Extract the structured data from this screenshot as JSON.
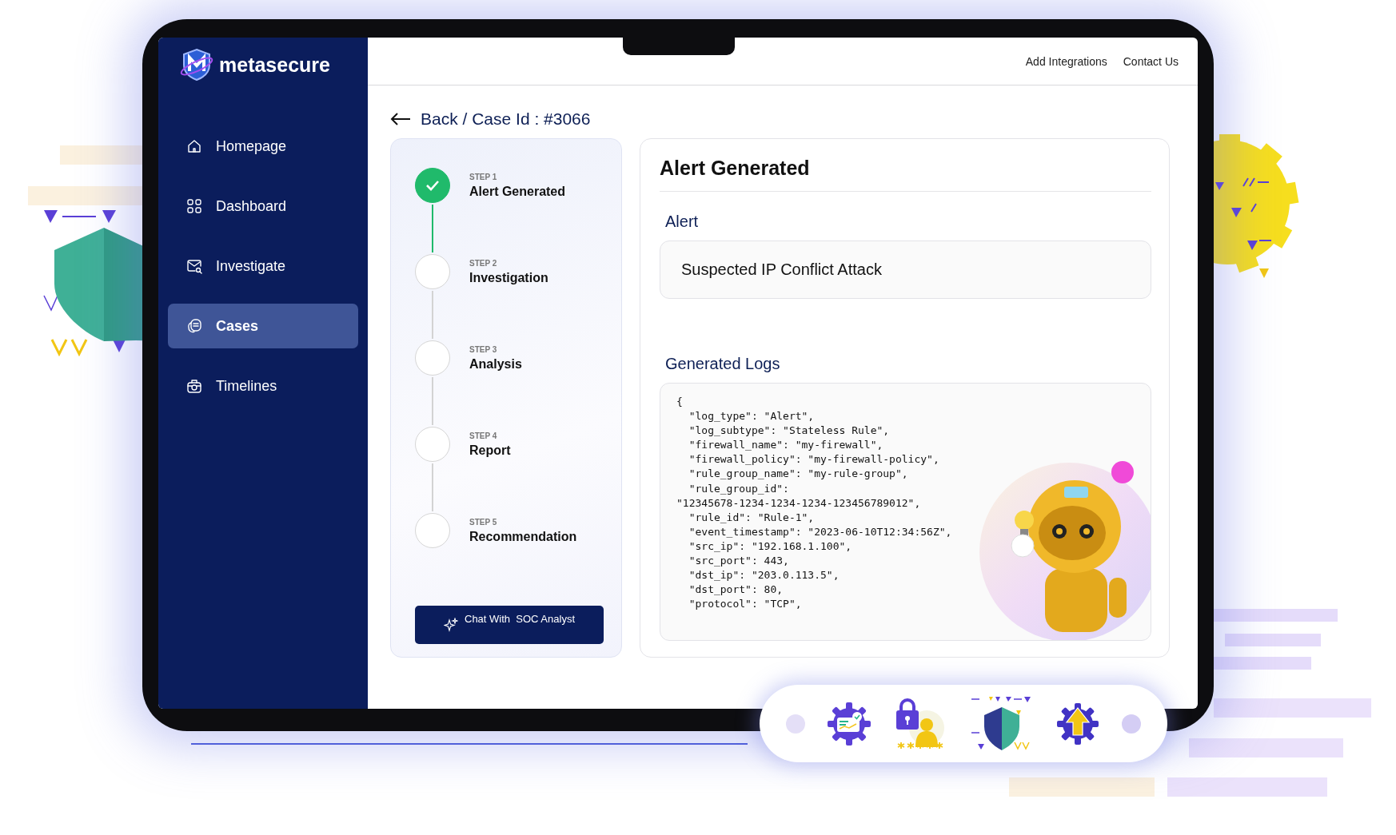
{
  "brand": {
    "name": "metasecure"
  },
  "sidebar": {
    "items": [
      {
        "label": "Homepage",
        "selected": false
      },
      {
        "label": "Dashboard",
        "selected": false
      },
      {
        "label": "Investigate",
        "selected": false
      },
      {
        "label": "Cases",
        "selected": true
      },
      {
        "label": "Timelines",
        "selected": false
      }
    ]
  },
  "header": {
    "links": [
      "Add Integrations",
      "Contact Us"
    ]
  },
  "breadcrumb": "Back / Case Id : #3066",
  "steps": [
    {
      "step": "STEP 1",
      "title": "Alert Generated",
      "done": true
    },
    {
      "step": "STEP 2",
      "title": "Investigation",
      "done": false
    },
    {
      "step": "STEP 3",
      "title": "Analysis",
      "done": false
    },
    {
      "step": "STEP 4",
      "title": "Report",
      "done": false
    },
    {
      "step": "STEP 5",
      "title": "Recommendation",
      "done": false
    }
  ],
  "chat_button": "Chat With  SOC Analyst",
  "detail": {
    "title": "Alert Generated",
    "alert_label": "Alert",
    "alert_value": "Suspected IP Conflict Attack",
    "logs_label": "Generated Logs",
    "log_lines": [
      "{",
      "  \"log_type\": \"Alert\",",
      "  \"log_subtype\": \"Stateless Rule\",",
      "  \"firewall_name\": \"my-firewall\",",
      "  \"firewall_policy\": \"my-firewall-policy\",",
      "  \"rule_group_name\": \"my-rule-group\",",
      "  \"rule_group_id\":",
      "\"12345678-1234-1234-1234-123456789012\",",
      "  \"rule_id\": \"Rule-1\",",
      "  \"event_timestamp\": \"2023-06-10T12:34:56Z\",",
      "  \"src_ip\": \"192.168.1.100\",",
      "  \"src_port\": 443,",
      "  \"dst_ip\": \"203.0.113.5\",",
      "  \"dst_port\": 80,",
      "  \"protocol\": \"TCP\","
    ]
  }
}
